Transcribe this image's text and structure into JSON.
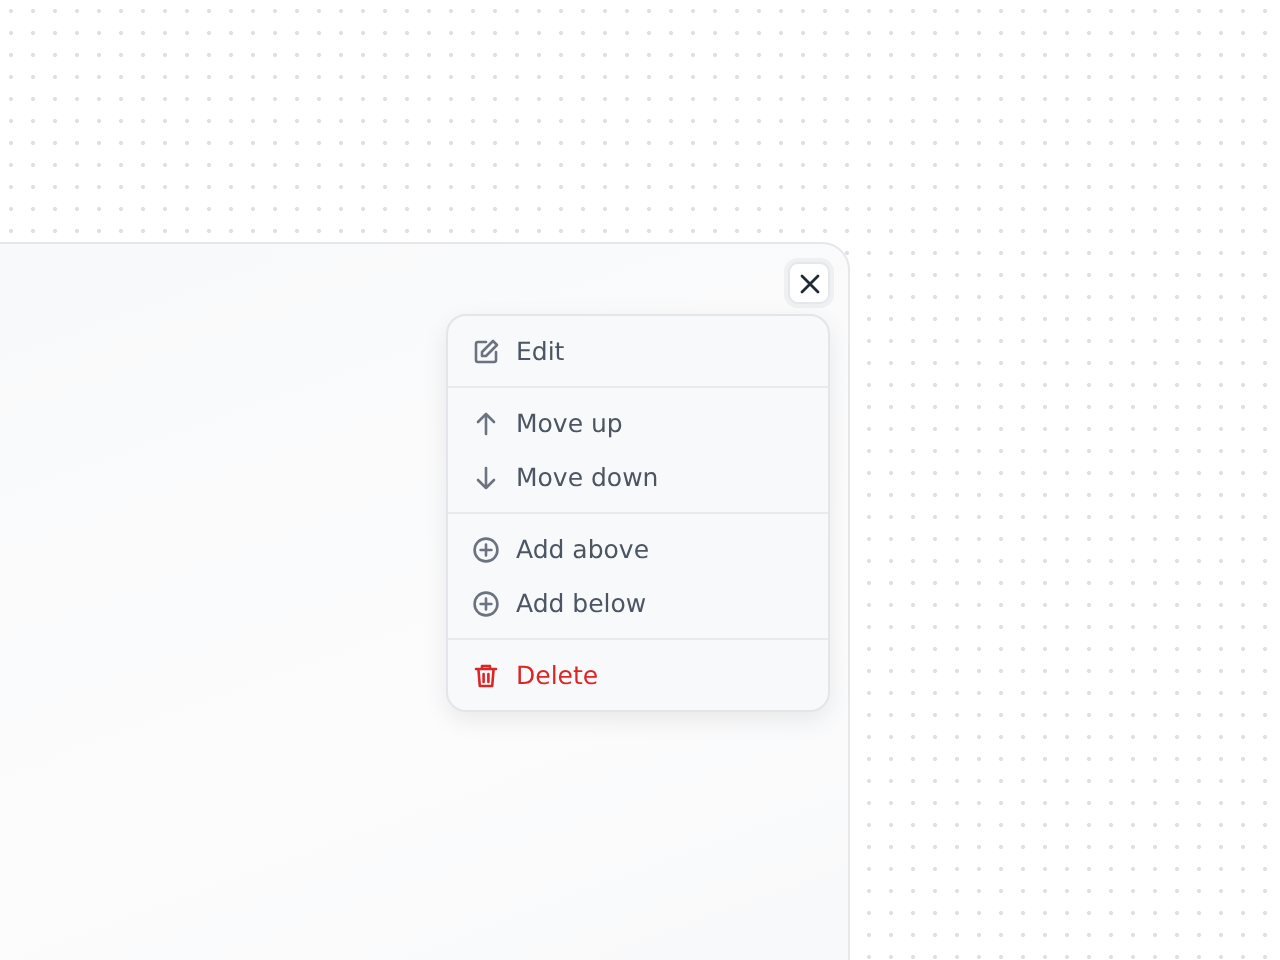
{
  "menu": {
    "groups": [
      [
        {
          "kind": "edit",
          "label": "Edit"
        }
      ],
      [
        {
          "kind": "up",
          "label": "Move up"
        },
        {
          "kind": "down",
          "label": "Move down"
        }
      ],
      [
        {
          "kind": "add",
          "label": "Add above"
        },
        {
          "kind": "add",
          "label": "Add below"
        }
      ],
      [
        {
          "kind": "delete",
          "label": "Delete"
        }
      ]
    ]
  }
}
